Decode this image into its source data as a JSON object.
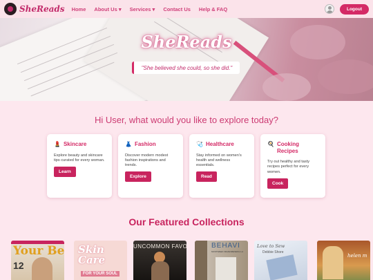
{
  "nav": {
    "brand": "SheReads",
    "links": [
      "Home",
      "About Us ▾",
      "Services ▾",
      "Contact Us",
      "Help & FAQ"
    ],
    "logout_label": "Logout"
  },
  "hero": {
    "title": "SheReads",
    "quote": "\"She believed she could, so she did.\""
  },
  "greeting": "Hi User, what would you like to explore today?",
  "cards": [
    {
      "icon": "💄",
      "title": "Skincare",
      "description": "Explore beauty and skincare tips curated for every woman.",
      "button": "Learn"
    },
    {
      "icon": "👗",
      "title": "Fashion",
      "description": "Discover modern modest fashion inspirations and trends.",
      "button": "Explore"
    },
    {
      "icon": "🩺",
      "title": "Healthcare",
      "description": "Stay informed on women's health and wellness essentials.",
      "button": "Read"
    },
    {
      "icon": "🍳",
      "title": "Cooking Recipes",
      "description": "Try out healthy and tasty recipes perfect for every women.",
      "button": "Cook"
    }
  ],
  "featured": {
    "title": "Our Featured Collections",
    "covers": [
      {
        "text": "Your Best You",
        "sub": "12"
      },
      {
        "text": "Skin Care",
        "sub": "FOR YOUR SOUL"
      },
      {
        "text": "UNCOMMON FAVO",
        "sub": ""
      },
      {
        "text": "BEHAVI",
        "sub": "MOSTWEEK DEVENMESENG LA"
      },
      {
        "text": "Love to Sew",
        "sub": "Debbie Shore"
      },
      {
        "text": "helen m",
        "sub": ""
      }
    ]
  },
  "colors": {
    "accent": "#c8245e",
    "background": "#fde7ee"
  }
}
